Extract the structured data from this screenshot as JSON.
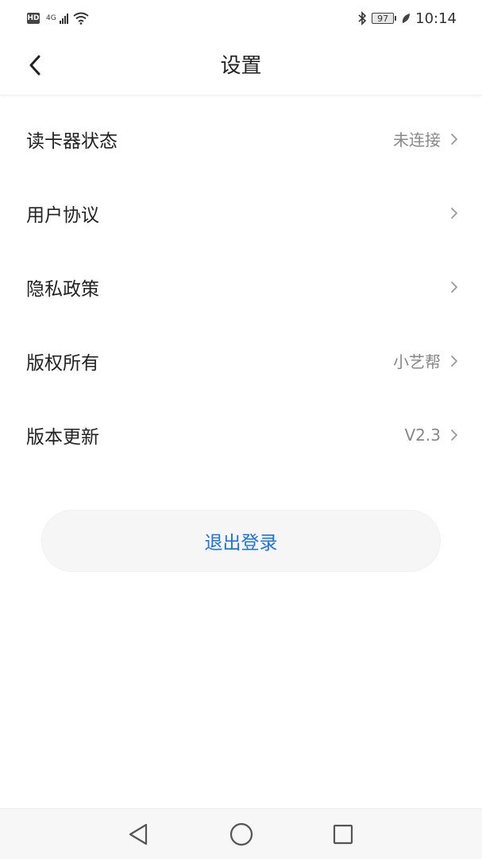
{
  "status_bar": {
    "hd": "HD",
    "network": "4G",
    "battery": "97",
    "time": "10:14"
  },
  "header": {
    "title": "设置"
  },
  "settings": [
    {
      "label": "读卡器状态",
      "value": "未连接"
    },
    {
      "label": "用户协议",
      "value": ""
    },
    {
      "label": "隐私政策",
      "value": ""
    },
    {
      "label": "版权所有",
      "value": "小艺帮"
    },
    {
      "label": "版本更新",
      "value": "V2.3"
    }
  ],
  "logout": {
    "label": "退出登录"
  },
  "colors": {
    "accent": "#1a73e8",
    "value_text": "#888888",
    "button_bg": "#f6f6f6"
  },
  "icons": {
    "back": "chevron-left-icon",
    "item_arrow": "chevron-right-icon",
    "nav_back": "triangle-back-icon",
    "nav_home": "circle-home-icon",
    "nav_recents": "square-recents-icon"
  }
}
